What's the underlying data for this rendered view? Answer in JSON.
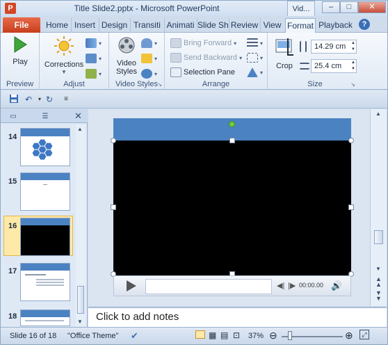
{
  "window": {
    "title": "Title Slide2.pptx - Microsoft PowerPoint",
    "context_tab_header": "Vid...",
    "controls": {
      "minimize": "–",
      "maximize": "□",
      "close": "✕"
    }
  },
  "tabs": {
    "file": "File",
    "items": [
      "Home",
      "Insert",
      "Design",
      "Transiti",
      "Animati",
      "Slide Sh",
      "Review",
      "View"
    ],
    "context": [
      "Format",
      "Playback"
    ],
    "active": "Format",
    "help": "?"
  },
  "ribbon": {
    "preview": {
      "label": "Preview",
      "play": "Play"
    },
    "adjust": {
      "label": "Adjust",
      "corrections": "Corrections"
    },
    "video_styles": {
      "label": "Video Styles",
      "button": "Video Styles"
    },
    "arrange": {
      "label": "Arrange",
      "bring_forward": "Bring Forward",
      "send_backward": "Send Backward",
      "selection_pane": "Selection Pane"
    },
    "size": {
      "label": "Size",
      "crop": "Crop",
      "height": "14.29 cm",
      "width": "25.4 cm"
    }
  },
  "panel": {
    "slides": [
      {
        "num": "14"
      },
      {
        "num": "15"
      },
      {
        "num": "16",
        "selected": true
      },
      {
        "num": "17"
      },
      {
        "num": "18"
      }
    ]
  },
  "media": {
    "time": "00:00.00"
  },
  "notes": {
    "placeholder": "Click to add notes"
  },
  "status": {
    "slide": "Slide 16 of 18",
    "theme": "\"Office Theme\"",
    "zoom": "37%",
    "zoom_level": 0.37
  },
  "colors": {
    "file_tab": "#d24726",
    "slide_header": "#4b82c2",
    "video": "#000000",
    "selection": "#ffe9a8"
  }
}
